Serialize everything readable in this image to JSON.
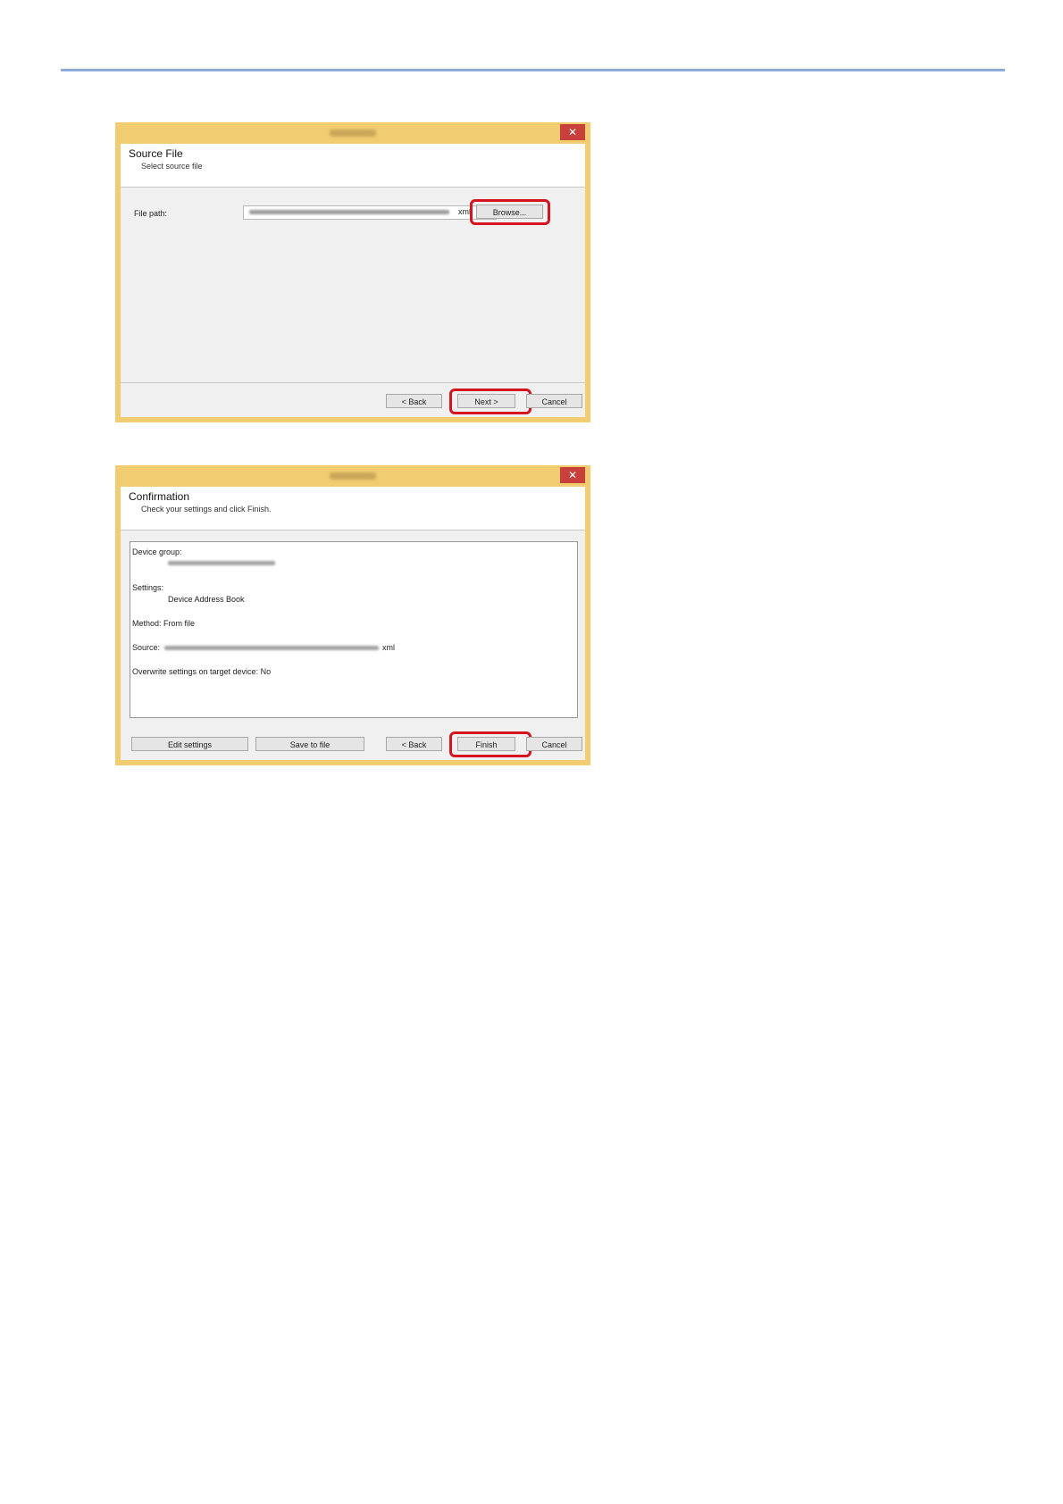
{
  "dialog1": {
    "close_glyph": "✕",
    "header_title": "Source File",
    "header_subtitle": "Select source file",
    "file_path_label": "File path:",
    "file_path_ext": "xml",
    "browse_label": "Browse...",
    "back_label": "< Back",
    "next_label": "Next >",
    "cancel_label": "Cancel"
  },
  "dialog2": {
    "close_glyph": "✕",
    "header_title": "Confirmation",
    "header_subtitle": "Check your settings and click Finish.",
    "summary": {
      "device_group_label": "Device group:",
      "settings_label": "Settings:",
      "settings_value": "Device Address Book",
      "method_line": "Method: From file",
      "source_label": "Source:",
      "source_ext": "xml",
      "overwrite_line": "Overwrite settings on target device: No"
    },
    "edit_settings_label": "Edit settings",
    "save_to_file_label": "Save to file",
    "back_label": "< Back",
    "finish_label": "Finish",
    "cancel_label": "Cancel"
  },
  "colors": {
    "accent_rule": "#8eaadb",
    "window_frame": "#f2cc70",
    "highlight": "#d4141f",
    "close_button": "#c8403a"
  }
}
